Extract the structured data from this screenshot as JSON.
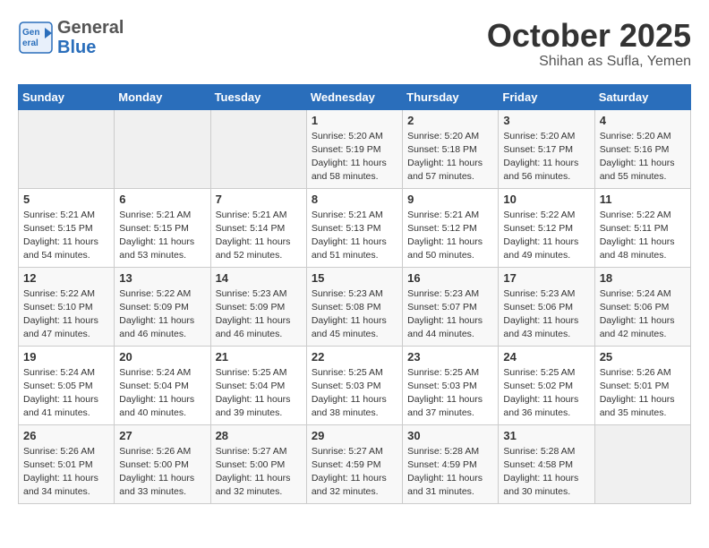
{
  "header": {
    "logo_line1": "General",
    "logo_line2": "Blue",
    "month": "October 2025",
    "location": "Shihan as Sufla, Yemen"
  },
  "weekdays": [
    "Sunday",
    "Monday",
    "Tuesday",
    "Wednesday",
    "Thursday",
    "Friday",
    "Saturday"
  ],
  "weeks": [
    [
      {
        "day": "",
        "empty": true
      },
      {
        "day": "",
        "empty": true
      },
      {
        "day": "",
        "empty": true
      },
      {
        "day": "1",
        "sunrise": "5:20 AM",
        "sunset": "5:19 PM",
        "daylight": "11 hours and 58 minutes."
      },
      {
        "day": "2",
        "sunrise": "5:20 AM",
        "sunset": "5:18 PM",
        "daylight": "11 hours and 57 minutes."
      },
      {
        "day": "3",
        "sunrise": "5:20 AM",
        "sunset": "5:17 PM",
        "daylight": "11 hours and 56 minutes."
      },
      {
        "day": "4",
        "sunrise": "5:20 AM",
        "sunset": "5:16 PM",
        "daylight": "11 hours and 55 minutes."
      }
    ],
    [
      {
        "day": "5",
        "sunrise": "5:21 AM",
        "sunset": "5:15 PM",
        "daylight": "11 hours and 54 minutes."
      },
      {
        "day": "6",
        "sunrise": "5:21 AM",
        "sunset": "5:15 PM",
        "daylight": "11 hours and 53 minutes."
      },
      {
        "day": "7",
        "sunrise": "5:21 AM",
        "sunset": "5:14 PM",
        "daylight": "11 hours and 52 minutes."
      },
      {
        "day": "8",
        "sunrise": "5:21 AM",
        "sunset": "5:13 PM",
        "daylight": "11 hours and 51 minutes."
      },
      {
        "day": "9",
        "sunrise": "5:21 AM",
        "sunset": "5:12 PM",
        "daylight": "11 hours and 50 minutes."
      },
      {
        "day": "10",
        "sunrise": "5:22 AM",
        "sunset": "5:12 PM",
        "daylight": "11 hours and 49 minutes."
      },
      {
        "day": "11",
        "sunrise": "5:22 AM",
        "sunset": "5:11 PM",
        "daylight": "11 hours and 48 minutes."
      }
    ],
    [
      {
        "day": "12",
        "sunrise": "5:22 AM",
        "sunset": "5:10 PM",
        "daylight": "11 hours and 47 minutes."
      },
      {
        "day": "13",
        "sunrise": "5:22 AM",
        "sunset": "5:09 PM",
        "daylight": "11 hours and 46 minutes."
      },
      {
        "day": "14",
        "sunrise": "5:23 AM",
        "sunset": "5:09 PM",
        "daylight": "11 hours and 46 minutes."
      },
      {
        "day": "15",
        "sunrise": "5:23 AM",
        "sunset": "5:08 PM",
        "daylight": "11 hours and 45 minutes."
      },
      {
        "day": "16",
        "sunrise": "5:23 AM",
        "sunset": "5:07 PM",
        "daylight": "11 hours and 44 minutes."
      },
      {
        "day": "17",
        "sunrise": "5:23 AM",
        "sunset": "5:06 PM",
        "daylight": "11 hours and 43 minutes."
      },
      {
        "day": "18",
        "sunrise": "5:24 AM",
        "sunset": "5:06 PM",
        "daylight": "11 hours and 42 minutes."
      }
    ],
    [
      {
        "day": "19",
        "sunrise": "5:24 AM",
        "sunset": "5:05 PM",
        "daylight": "11 hours and 41 minutes."
      },
      {
        "day": "20",
        "sunrise": "5:24 AM",
        "sunset": "5:04 PM",
        "daylight": "11 hours and 40 minutes."
      },
      {
        "day": "21",
        "sunrise": "5:25 AM",
        "sunset": "5:04 PM",
        "daylight": "11 hours and 39 minutes."
      },
      {
        "day": "22",
        "sunrise": "5:25 AM",
        "sunset": "5:03 PM",
        "daylight": "11 hours and 38 minutes."
      },
      {
        "day": "23",
        "sunrise": "5:25 AM",
        "sunset": "5:03 PM",
        "daylight": "11 hours and 37 minutes."
      },
      {
        "day": "24",
        "sunrise": "5:25 AM",
        "sunset": "5:02 PM",
        "daylight": "11 hours and 36 minutes."
      },
      {
        "day": "25",
        "sunrise": "5:26 AM",
        "sunset": "5:01 PM",
        "daylight": "11 hours and 35 minutes."
      }
    ],
    [
      {
        "day": "26",
        "sunrise": "5:26 AM",
        "sunset": "5:01 PM",
        "daylight": "11 hours and 34 minutes."
      },
      {
        "day": "27",
        "sunrise": "5:26 AM",
        "sunset": "5:00 PM",
        "daylight": "11 hours and 33 minutes."
      },
      {
        "day": "28",
        "sunrise": "5:27 AM",
        "sunset": "5:00 PM",
        "daylight": "11 hours and 32 minutes."
      },
      {
        "day": "29",
        "sunrise": "5:27 AM",
        "sunset": "4:59 PM",
        "daylight": "11 hours and 32 minutes."
      },
      {
        "day": "30",
        "sunrise": "5:28 AM",
        "sunset": "4:59 PM",
        "daylight": "11 hours and 31 minutes."
      },
      {
        "day": "31",
        "sunrise": "5:28 AM",
        "sunset": "4:58 PM",
        "daylight": "11 hours and 30 minutes."
      },
      {
        "day": "",
        "empty": true
      }
    ]
  ],
  "labels": {
    "sunrise": "Sunrise:",
    "sunset": "Sunset:",
    "daylight": "Daylight:"
  }
}
